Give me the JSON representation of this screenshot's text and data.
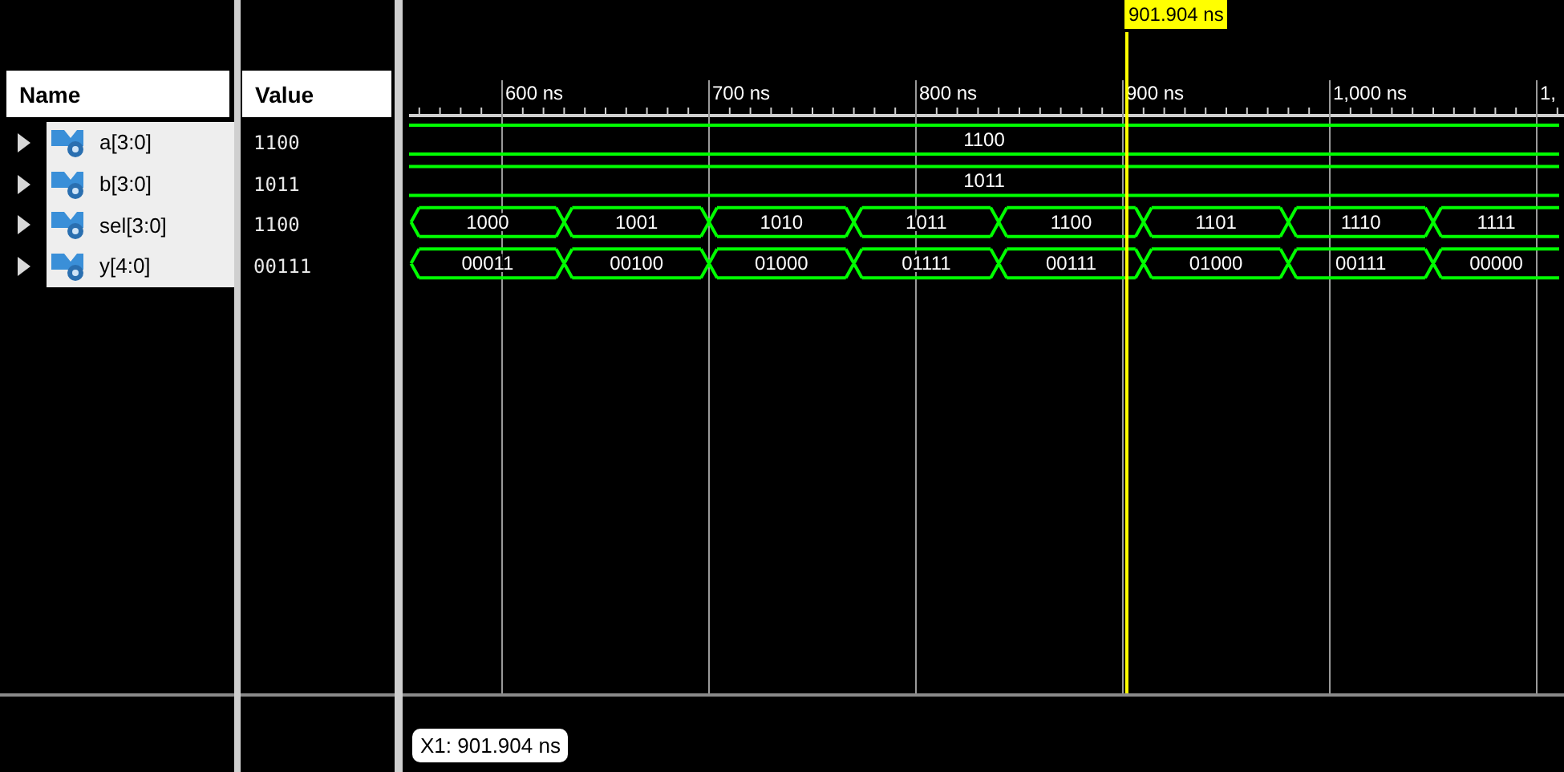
{
  "names_header": "Name",
  "values_header": "Value",
  "signals": [
    {
      "name": "a[3:0]",
      "value": "1100",
      "expanded": false,
      "segments": [
        "1100"
      ]
    },
    {
      "name": "b[3:0]",
      "value": "1011",
      "expanded": false,
      "segments": [
        "1011"
      ]
    },
    {
      "name": "sel[3:0]",
      "value": "1100",
      "expanded": false,
      "segments": [
        "1000",
        "1001",
        "1010",
        "1011",
        "1100",
        "1101",
        "1110",
        "1111"
      ]
    },
    {
      "name": "y[4:0]",
      "value": "00111",
      "expanded": false,
      "segments": [
        "00011",
        "00100",
        "01000",
        "01111",
        "00111",
        "01000",
        "00111",
        "00000"
      ]
    }
  ],
  "time_axis": [
    "600 ns",
    "700 ns",
    "800 ns",
    "900 ns",
    "1,000 ns",
    "1,"
  ],
  "cursor": {
    "label": "901.904 ns",
    "readout": "X1: 901.904 ns"
  }
}
